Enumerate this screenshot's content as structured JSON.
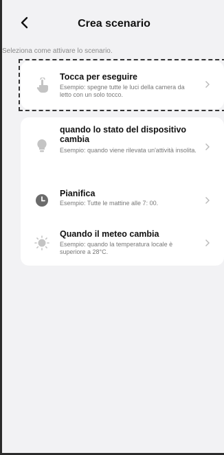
{
  "header": {
    "back_icon": "chevron-left-icon",
    "title": "Crea scenario"
  },
  "hint": "Seleziona come attivare lo scenario.",
  "options": [
    {
      "icon": "tap-hand-icon",
      "title": "Tocca per eseguire",
      "description": "Esempio: spegne tutte le luci della camera da letto con un solo tocco."
    },
    {
      "icon": "lightbulb-icon",
      "title": "quando lo stato del dispositivo cambia",
      "description": "Esempio: quando viene rilevata un'attività insolita."
    },
    {
      "icon": "clock-icon",
      "title": "Pianifica",
      "description": "Esempio: Tutte le mattine alle 7: 00."
    },
    {
      "icon": "sun-icon",
      "title": "Quando il meteo cambia",
      "description": "Esempio: quando la temperatura locale è superiore a 28°C."
    }
  ],
  "colors": {
    "background": "#f2f2f4",
    "card": "#ffffff",
    "icon_gray": "#c4c4c4",
    "clock_gray": "#6b6b6b"
  }
}
